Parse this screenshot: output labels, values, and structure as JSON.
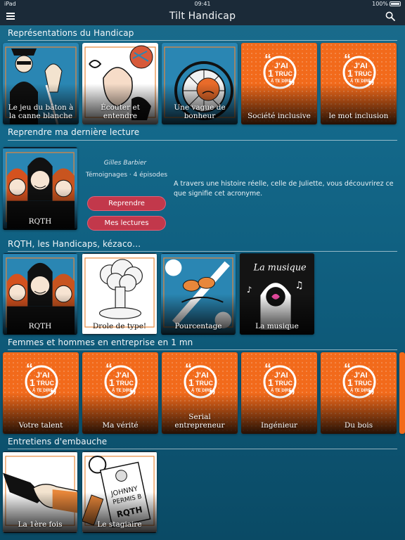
{
  "status": {
    "device": "iPad",
    "time": "09:41",
    "battery": "100%"
  },
  "nav": {
    "title": "Tilt Handicap",
    "menu_icon": "hamburger-menu-icon",
    "search_icon": "search-icon"
  },
  "sections": [
    {
      "title": "Représentations du Handicap",
      "cards": [
        {
          "label": "Le jeu du bâton à la canne blanche",
          "art": "blind-man-illustration"
        },
        {
          "label": "Écouter et entendre",
          "art": "ear-music-illustration"
        },
        {
          "label": "Une vague de bonheur",
          "art": "wheelchair-illustration"
        },
        {
          "label": "Société inclusive",
          "art": "jai-truc-logo"
        },
        {
          "label": "le mot inclusion",
          "art": "jai-truc-logo"
        }
      ]
    },
    {
      "title": "Reprendre ma dernière lecture",
      "resume": {
        "card_label": "RQTH",
        "author": "Gilles Barbier",
        "meta": "Témoignages · 4 épisodes",
        "resume_button": "Reprendre",
        "my_reads_button": "Mes lectures",
        "description": "A travers une histoire réelle, celle de Juliette, vous découvrirez ce que signifie cet acronyme."
      }
    },
    {
      "title": "RQTH, les Handicaps, kézaco…",
      "cards": [
        {
          "label": "RQTH",
          "art": "three-women-illustration"
        },
        {
          "label": "Drole de type!",
          "art": "mushroom-cloud-illustration"
        },
        {
          "label": "Pourcentage",
          "art": "percent-illustration"
        },
        {
          "label": "La musique",
          "art": "la-musique-illustration"
        }
      ]
    },
    {
      "title": "Femmes et hommes en entreprise en 1 mn",
      "cards": [
        {
          "label": "Votre talent",
          "art": "jai-truc-logo"
        },
        {
          "label": "Ma vérité",
          "art": "jai-truc-logo"
        },
        {
          "label": "Serial entrepreneur",
          "art": "jai-truc-logo"
        },
        {
          "label": "Ingénieur",
          "art": "jai-truc-logo"
        },
        {
          "label": "Du bois",
          "art": "jai-truc-logo"
        }
      ]
    },
    {
      "title": "Entretiens d'embauche",
      "cards": [
        {
          "label": "La 1ère fois",
          "art": "handshake-illustration"
        },
        {
          "label": "Le stagiaire",
          "art": "badge-rqth-illustration"
        }
      ]
    }
  ],
  "logo_text": {
    "line1": "J'AI",
    "line2": "1",
    "line3": "TRUC",
    "line4": "À TE DIRE"
  },
  "colors": {
    "nav_bg": "#1b2a38",
    "accent_orange": "#f26a1b",
    "pill_red": "#c2384b",
    "bg_teal": "#146a8c"
  }
}
